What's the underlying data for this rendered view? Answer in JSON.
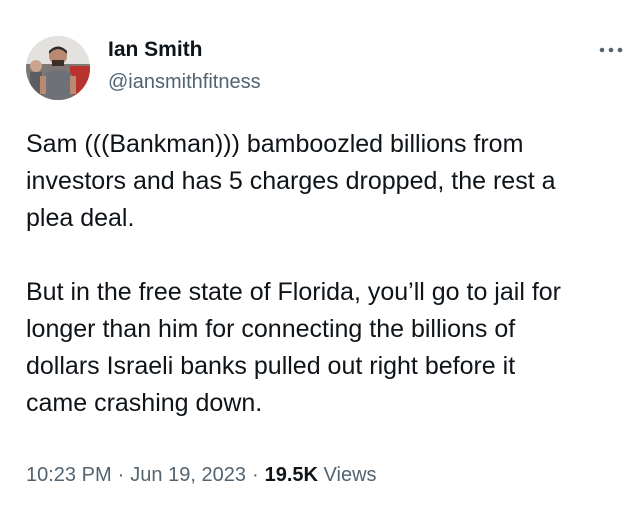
{
  "author": {
    "display_name": "Ian Smith",
    "handle": "@iansmithfitness",
    "avatar_icon": "profile-photo"
  },
  "more_icon": "more-horizontal-icon",
  "tweet": {
    "text": "Sam (((Bankman))) bamboozled billions from\ninvestors and has 5 charges dropped, the rest a\nplea deal.\n\nBut in the free state of Florida, you’ll go to jail for\nlonger than him for connecting the billions of\ndollars Israeli banks pulled out right before it\ncame crashing down."
  },
  "meta": {
    "time": "10:23 PM",
    "separator": "·",
    "date": "Jun 19, 2023",
    "views_count": "19.5K",
    "views_label": "Views"
  },
  "colors": {
    "text": "#0f1419",
    "secondary": "#536471",
    "background": "#ffffff"
  }
}
